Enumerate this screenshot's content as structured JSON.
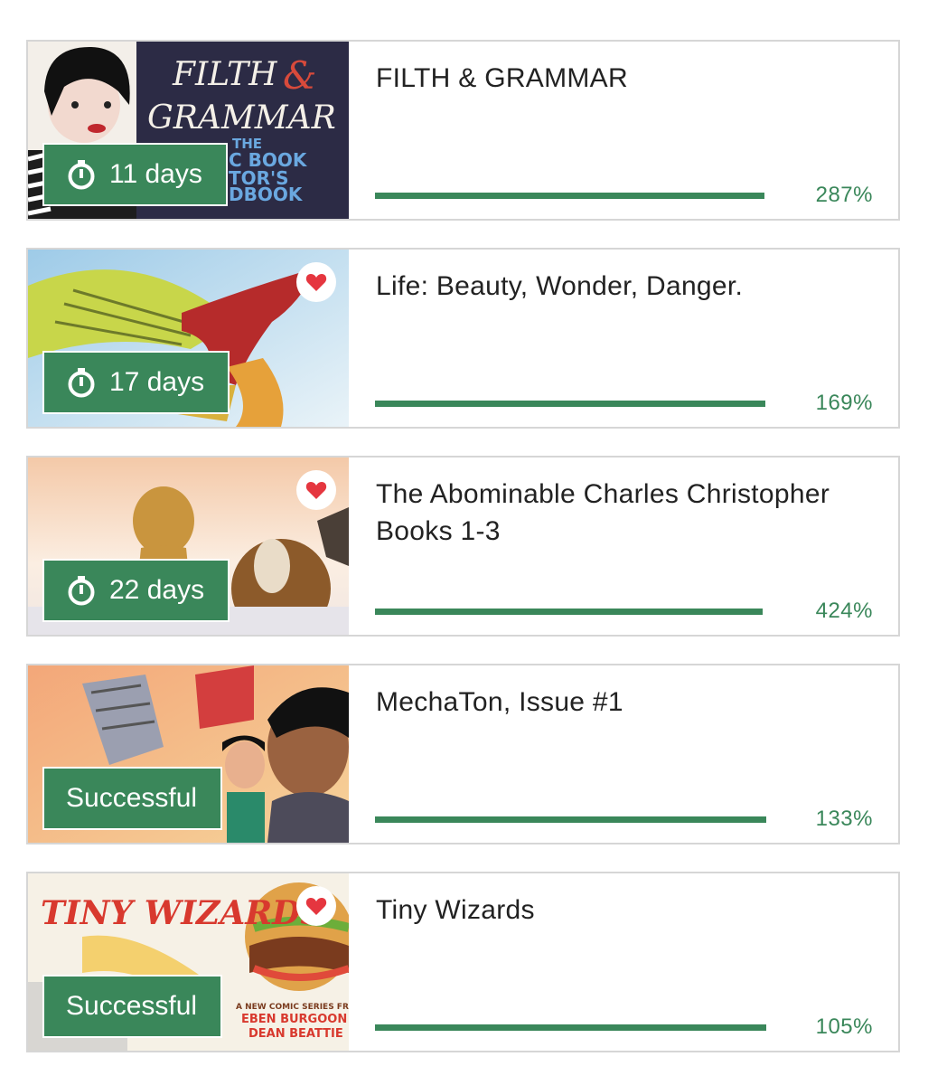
{
  "accent_color": "#3a875a",
  "projects": [
    {
      "title": "FILTH & GRAMMAR",
      "badge": "11 days",
      "badge_icon": "stopwatch-icon",
      "favorited": false,
      "funded_percent_label": "287%",
      "funded_percent": 287,
      "cover_text": [
        "FILTH",
        "&",
        "GRAMMAR",
        "THE",
        "C BOOK",
        "TOR'S",
        "DBOOK"
      ]
    },
    {
      "title": "Life: Beauty, Wonder, Danger.",
      "badge": "17 days",
      "badge_icon": "stopwatch-icon",
      "favorited": true,
      "funded_percent_label": "169%",
      "funded_percent": 169
    },
    {
      "title": "The Abominable Charles Christopher Books 1-3",
      "badge": "22 days",
      "badge_icon": "stopwatch-icon",
      "favorited": true,
      "funded_percent_label": "424%",
      "funded_percent": 424
    },
    {
      "title": "MechaTon, Issue #1",
      "badge": "Successful",
      "badge_icon": "",
      "favorited": false,
      "funded_percent_label": "133%",
      "funded_percent": 133
    },
    {
      "title": "Tiny Wizards",
      "badge": "Successful",
      "badge_icon": "",
      "favorited": true,
      "funded_percent_label": "105%",
      "funded_percent": 105,
      "cover_text": [
        "TINY WIZARDS",
        "A NEW COMIC SERIES FROM:",
        "EBEN BURGOON",
        "DEAN BEATTIE"
      ]
    }
  ]
}
